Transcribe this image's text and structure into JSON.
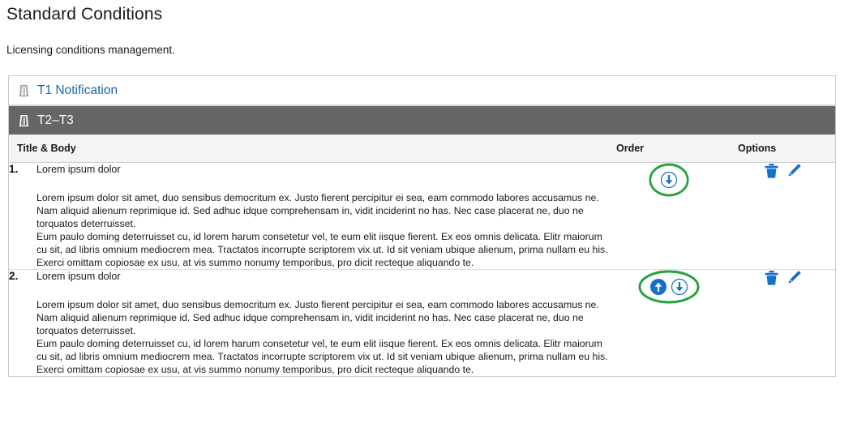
{
  "header": {
    "title": "Standard Conditions",
    "subtitle": "Licensing conditions management."
  },
  "accordions": [
    {
      "label": "T1 Notification",
      "icon": "pillar-icon",
      "state": "collapsed"
    },
    {
      "label": "T2–T3",
      "icon": "pillar-icon",
      "state": "expanded"
    }
  ],
  "table": {
    "columns": {
      "title": "Title & Body",
      "order": "Order",
      "options": "Options"
    },
    "rows": [
      {
        "number": "1.",
        "name": "Lorem ipsum dolor",
        "body_paragraph_1": "Lorem ipsum dolor sit amet, duo sensibus democritum ex. Justo fierent percipitur ei sea, eam commodo labores accusamus ne. Nam aliquid alienum reprimique id. Sed adhuc idque comprehensam in, vidit inciderint no has. Nec case placerat ne, duo ne torquatos deterruisset.",
        "body_paragraph_2": "Eum paulo doming deterruisset cu, id lorem harum consetetur vel, te eum elit iisque fierent. Ex eos omnis delicata. Elitr maiorum cu sit, ad libris omnium mediocrem mea. Tractatos incorrupte scriptorem vix ut. Id sit veniam ubique alienum, prima nullam eu his. Exerci omittam copiosae ex usu, at vis summo nonumy temporibus, pro dicit recteque aliquando te.",
        "order_buttons": [
          "move-down"
        ],
        "highlighted": true,
        "options": [
          "delete",
          "edit"
        ]
      },
      {
        "number": "2.",
        "name": "Lorem ipsum dolor",
        "body_paragraph_1": "Lorem ipsum dolor sit amet, duo sensibus democritum ex. Justo fierent percipitur ei sea, eam commodo labores accusamus ne. Nam aliquid alienum reprimique id. Sed adhuc idque comprehensam in, vidit inciderint no has. Nec case placerat ne, duo ne torquatos deterruisset.",
        "body_paragraph_2": "Eum paulo doming deterruisset cu, id lorem harum consetetur vel, te eum elit iisque fierent. Ex eos omnis delicata. Elitr maiorum cu sit, ad libris omnium mediocrem mea. Tractatos incorrupte scriptorem vix ut. Id sit veniam ubique alienum, prima nullam eu his. Exerci omittam copiosae ex usu, at vis summo nonumy temporibus, pro dicit recteque aliquando te.",
        "order_buttons": [
          "move-up",
          "move-down"
        ],
        "highlighted": true,
        "options": [
          "delete",
          "edit"
        ]
      }
    ]
  },
  "colors": {
    "link": "#2065b0",
    "expanded_header_bg": "#666666",
    "icon_blue": "#1570c8",
    "highlight_green": "#24a33e",
    "table_header_bg": "#f4f4f4",
    "panel_border": "#c8c8c8"
  }
}
